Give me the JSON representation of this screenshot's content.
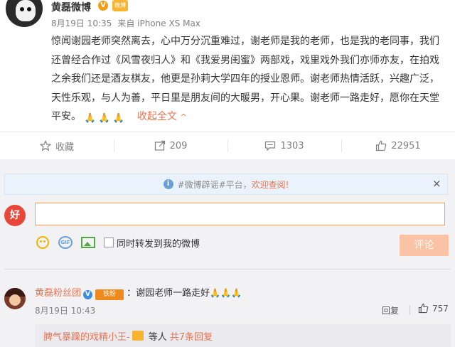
{
  "post": {
    "author": "黄磊微博",
    "vip_badge_text": "微博",
    "date": "8月19日 10:35",
    "source": "来自 iPhone XS Max",
    "body": "惊闻谢园老师突然离去，心中万分沉重难过，谢老师是我的老师，也是我的老同事，我们还曾经合作过《风雪夜归人》和《我爱男闺蜜》两部戏，戏里戏外我们亦师亦友，在拍戏之余我们还是酒友棋友，他更是孙莉大学四年的授业恩师。谢老师热情活跃，兴趣广泛，天性乐观，与人为善，平日里是朋友间的大暖男，开心果。谢老师一路走好，愿你在天堂平安。",
    "emoji": [
      "🙏",
      "🙏",
      "🙏"
    ],
    "collapse_label": "收起全文",
    "collapse_caret": "^"
  },
  "actions": {
    "favorite": "收藏",
    "repost": "209",
    "comment": "1303",
    "like": "22951"
  },
  "notice": {
    "prefix": "#微博辟谣#平台，",
    "link": "欢迎查阅!",
    "close": "×"
  },
  "composer": {
    "avatar_text": "好",
    "input_value": "",
    "gif_label": "GIF",
    "repost_label": "同时转发到我的微博",
    "submit_label": "评论"
  },
  "comment": {
    "author": "黄磊粉丝团",
    "v_mark": "V",
    "badge_text": "铁粉",
    "text": "：谢园老师一路走好",
    "emoji": "🙏🙏🙏",
    "time": "8月19日 10:43",
    "reply_label": "回复",
    "like_count": "757"
  },
  "subreply": {
    "user": "脾气暴躁的戏精小王-",
    "etc": "等人",
    "count": "共7条回复"
  },
  "colors": {
    "accent": "#eb7350",
    "notice_bg": "#eaf3fb",
    "panel_bg": "#f2f2f5"
  }
}
